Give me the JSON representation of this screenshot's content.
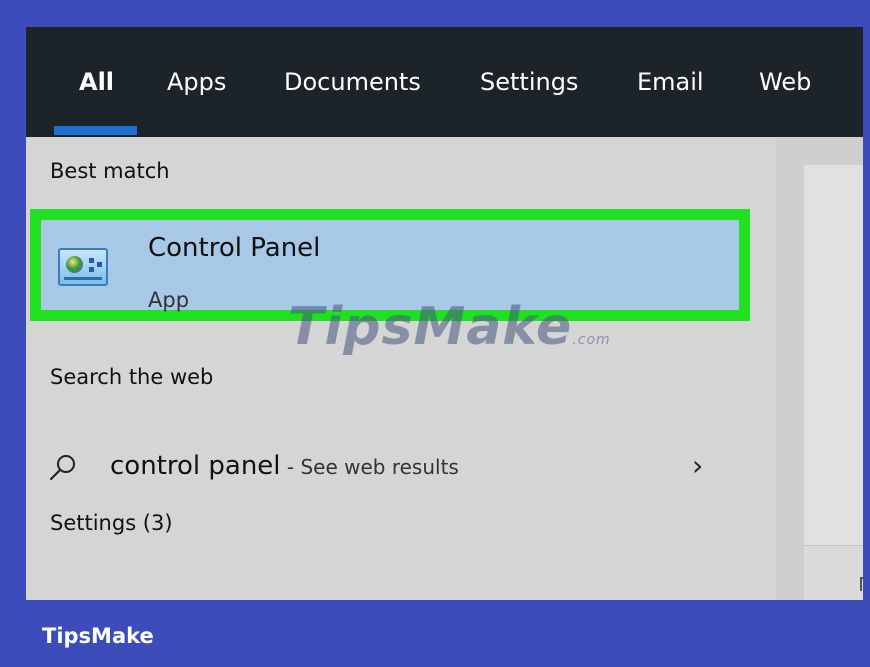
{
  "tabs": [
    {
      "label": "All",
      "active": true
    },
    {
      "label": "Apps",
      "active": false
    },
    {
      "label": "Documents",
      "active": false
    },
    {
      "label": "Settings",
      "active": false
    },
    {
      "label": "Email",
      "active": false
    },
    {
      "label": "Web",
      "active": false
    }
  ],
  "sections": {
    "best_match": "Best match",
    "search_web": "Search the web",
    "settings": "Settings (3)"
  },
  "best_result": {
    "title": "Control Panel",
    "subtitle": "App",
    "icon": "control-panel-icon"
  },
  "web_result": {
    "query": "control panel",
    "suffix": " - See web results",
    "icon": "search-icon",
    "chevron": "›"
  },
  "watermark": {
    "text": "TipsMake",
    "suffix": ".com"
  },
  "footer": {
    "brand": "TipsMake"
  },
  "colors": {
    "frame_border": "#3c4cbb",
    "tab_bar": "#1c2429",
    "tab_underline": "#1f6fd1",
    "highlight_border": "#21e021",
    "selected_bg": "#a8c8e8",
    "panel_bg": "#d5d5d5"
  }
}
